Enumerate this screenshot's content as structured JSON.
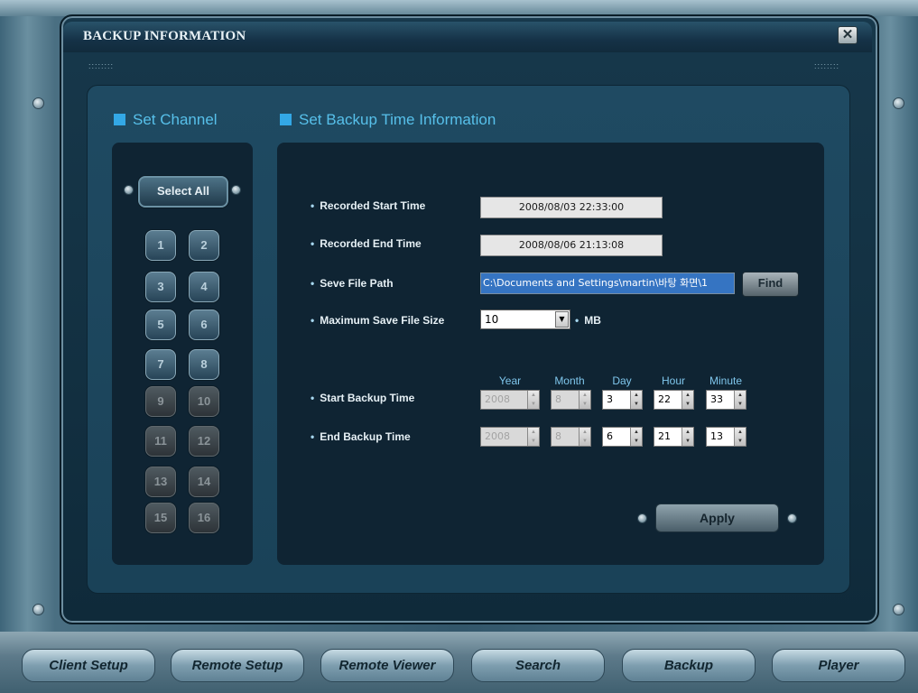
{
  "window": {
    "title": "BACKUP INFORMATION",
    "grip_text": "::::::::"
  },
  "channel": {
    "section_title": "Set Channel",
    "select_all_label": "Select All",
    "channels": [
      {
        "label": "1",
        "enabled": true
      },
      {
        "label": "2",
        "enabled": true
      },
      {
        "label": "3",
        "enabled": true
      },
      {
        "label": "4",
        "enabled": true
      },
      {
        "label": "5",
        "enabled": true
      },
      {
        "label": "6",
        "enabled": true
      },
      {
        "label": "7",
        "enabled": true
      },
      {
        "label": "8",
        "enabled": true
      },
      {
        "label": "9",
        "enabled": false
      },
      {
        "label": "10",
        "enabled": false
      },
      {
        "label": "11",
        "enabled": false
      },
      {
        "label": "12",
        "enabled": false
      },
      {
        "label": "13",
        "enabled": false
      },
      {
        "label": "14",
        "enabled": false
      },
      {
        "label": "15",
        "enabled": false
      },
      {
        "label": "16",
        "enabled": false
      }
    ]
  },
  "backup": {
    "section_title": "Set Backup Time Information",
    "recorded_start_label": "Recorded Start Time",
    "recorded_start_value": "2008/08/03 22:33:00",
    "recorded_end_label": "Recorded End Time",
    "recorded_end_value": "2008/08/06 21:13:08",
    "file_path_label": "Seve File Path",
    "file_path_value": "C:\\Documents and Settings\\martin\\바탕 화면\\1",
    "find_label": "Find",
    "max_size_label": "Maximum Save File Size",
    "max_size_value": "10",
    "max_size_unit": "MB",
    "columns": {
      "year": "Year",
      "month": "Month",
      "day": "Day",
      "hour": "Hour",
      "minute": "Minute"
    },
    "start_label": "Start Backup Time",
    "start": {
      "year": "2008",
      "month": "8",
      "day": "3",
      "hour": "22",
      "minute": "33"
    },
    "end_label": "End Backup Time",
    "end": {
      "year": "2008",
      "month": "8",
      "day": "6",
      "hour": "21",
      "minute": "13"
    },
    "apply_label": "Apply"
  },
  "nav": {
    "client_setup": "Client Setup",
    "remote_setup": "Remote Setup",
    "remote_viewer": "Remote Viewer",
    "search": "Search",
    "backup": "Backup",
    "player": "Player"
  },
  "colors": {
    "accent": "#33a8e6",
    "panel": "#0f2433",
    "path_highlight": "#3574c2"
  }
}
